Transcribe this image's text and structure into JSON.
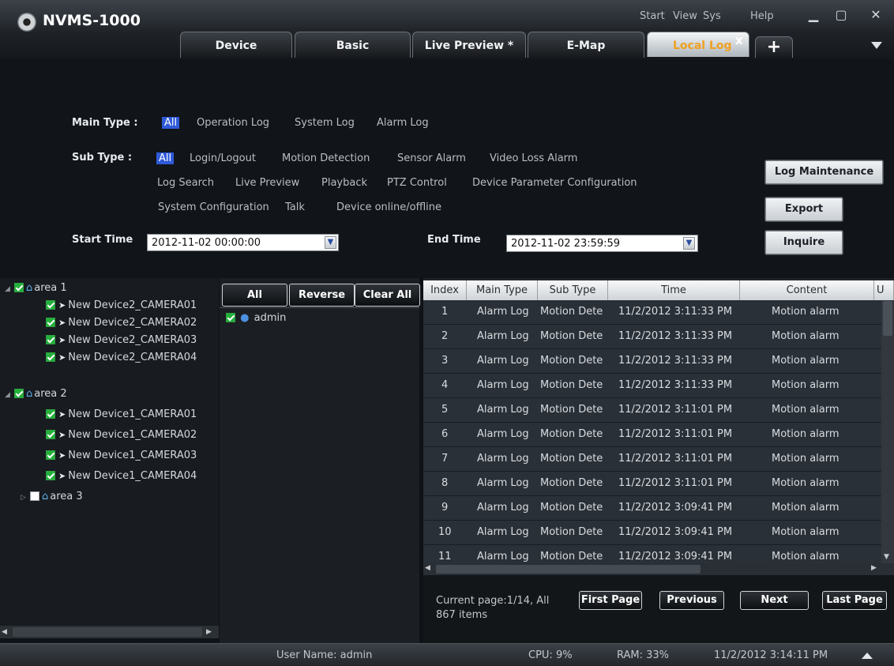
{
  "app": {
    "title": "NVMS-1000"
  },
  "system_menu": {
    "start": "Start",
    "view": "View",
    "sys": "Sys",
    "help": "Help"
  },
  "window_controls": {
    "minimize": "▁",
    "maximize": "▢",
    "close": "✕"
  },
  "tabs": [
    {
      "label": "Device",
      "active": false
    },
    {
      "label": "Basic",
      "active": false
    },
    {
      "label": "Live Preview *",
      "active": false
    },
    {
      "label": "E-Map",
      "active": false
    },
    {
      "label": "Local Log",
      "active": true
    }
  ],
  "tab_close": "x",
  "tab_add": "+",
  "filters": {
    "main_type_label": "Main Type :",
    "main_types": [
      "All",
      "Operation Log",
      "System Log",
      "Alarm Log"
    ],
    "main_type_selected": "All",
    "sub_type_label": "Sub Type :",
    "sub_types_row1": [
      "All",
      "Login/Logout",
      "Motion Detection",
      "Sensor Alarm",
      "Video Loss Alarm"
    ],
    "sub_types_row2": [
      "Log Search",
      "Live Preview",
      "Playback",
      "PTZ Control",
      "Device Parameter Configuration"
    ],
    "sub_types_row3": [
      "System Configuration",
      "Talk",
      "Device online/offline"
    ],
    "sub_type_selected": "All",
    "start_time_label": "Start Time",
    "start_time": "2012-11-02 00:00:00",
    "end_time_label": "End Time",
    "end_time": "2012-11-02 23:59:59"
  },
  "actions": {
    "log_maintenance": "Log Maintenance",
    "export": "Export",
    "inquire": "Inquire"
  },
  "tree": {
    "areas": [
      {
        "name": "area 1",
        "checked": true,
        "expanded": true,
        "cameras": [
          "New Device2_CAMERA01",
          "New Device2_CAMERA02",
          "New Device2_CAMERA03",
          "New Device2_CAMERA04"
        ]
      },
      {
        "name": "area 2",
        "checked": true,
        "expanded": true,
        "cameras": [
          "New Device1_CAMERA01",
          "New Device1_CAMERA02",
          "New Device1_CAMERA03",
          "New Device1_CAMERA04"
        ]
      },
      {
        "name": "area 3",
        "checked": false,
        "expanded": false,
        "cameras": []
      }
    ]
  },
  "users": {
    "buttons": {
      "all": "All",
      "reverse": "Reverse",
      "clear_all": "Clear All"
    },
    "list": [
      {
        "name": "admin",
        "checked": true
      }
    ]
  },
  "table": {
    "columns": [
      "Index",
      "Main Type",
      "Sub Type",
      "Time",
      "Content",
      "U"
    ],
    "rows": [
      [
        "1",
        "Alarm Log",
        "Motion Dete",
        "11/2/2012 3:11:33 PM",
        "Motion alarm"
      ],
      [
        "2",
        "Alarm Log",
        "Motion Dete",
        "11/2/2012 3:11:33 PM",
        "Motion alarm"
      ],
      [
        "3",
        "Alarm Log",
        "Motion Dete",
        "11/2/2012 3:11:33 PM",
        "Motion alarm"
      ],
      [
        "4",
        "Alarm Log",
        "Motion Dete",
        "11/2/2012 3:11:33 PM",
        "Motion alarm"
      ],
      [
        "5",
        "Alarm Log",
        "Motion Dete",
        "11/2/2012 3:11:01 PM",
        "Motion alarm"
      ],
      [
        "6",
        "Alarm Log",
        "Motion Dete",
        "11/2/2012 3:11:01 PM",
        "Motion alarm"
      ],
      [
        "7",
        "Alarm Log",
        "Motion Dete",
        "11/2/2012 3:11:01 PM",
        "Motion alarm"
      ],
      [
        "8",
        "Alarm Log",
        "Motion Dete",
        "11/2/2012 3:11:01 PM",
        "Motion alarm"
      ],
      [
        "9",
        "Alarm Log",
        "Motion Dete",
        "11/2/2012 3:09:41 PM",
        "Motion alarm"
      ],
      [
        "10",
        "Alarm Log",
        "Motion Dete",
        "11/2/2012 3:09:41 PM",
        "Motion alarm"
      ],
      [
        "11",
        "Alarm Log",
        "Motion Dete",
        "11/2/2012 3:09:41 PM",
        "Motion alarm"
      ]
    ]
  },
  "pagination": {
    "status_line1": "Current page:1/14, All",
    "status_line2": "867 items",
    "first": "First Page",
    "previous": "Previous",
    "next": "Next",
    "last": "Last Page"
  },
  "status": {
    "user": "User Name: admin",
    "cpu": "CPU: 9%",
    "ram": "RAM: 33%",
    "datetime": "11/2/2012 3:14:11 PM"
  },
  "colors": {
    "selected_blue": "#2f5ad8",
    "active_tab_text": "#f0a020",
    "check_green": "#23b13a"
  }
}
